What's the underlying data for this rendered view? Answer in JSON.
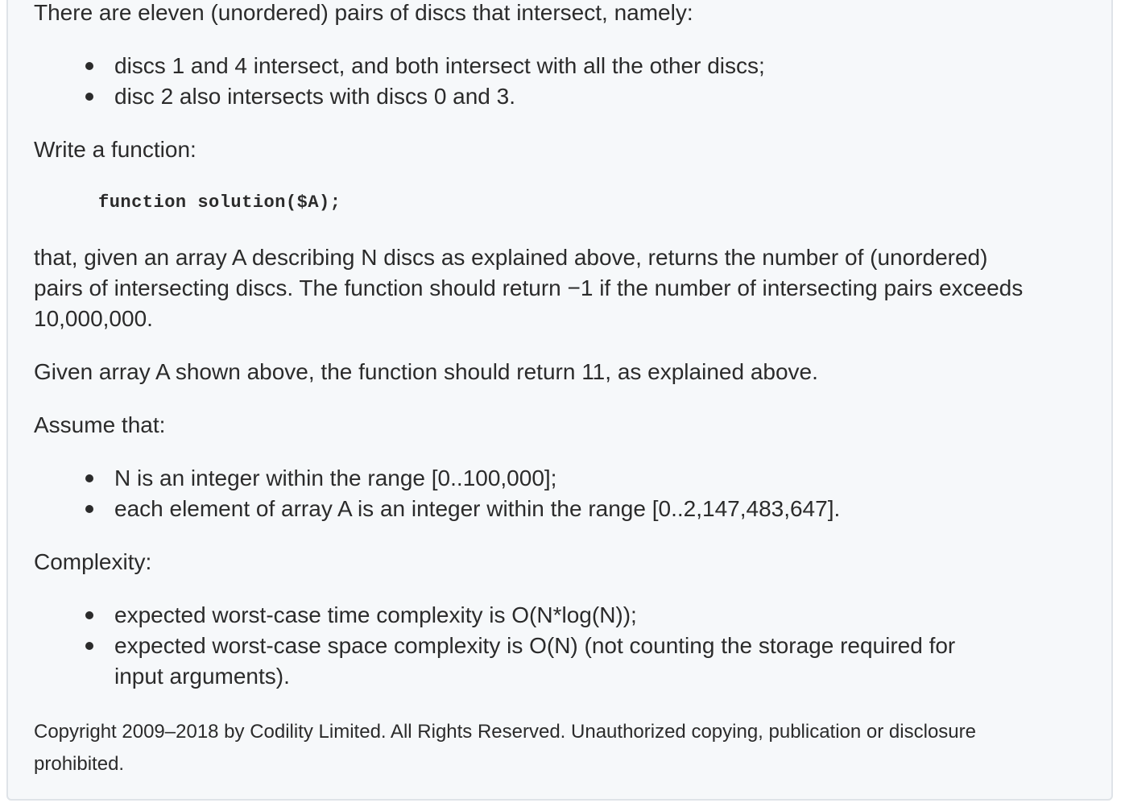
{
  "intro": "There are eleven (unordered) pairs of discs that intersect, namely:",
  "pairs_list": [
    "discs 1 and 4 intersect, and both intersect with all the other discs;",
    "disc 2 also intersects with discs 0 and 3."
  ],
  "write_function": "Write a function:",
  "signature": "function solution($A);",
  "description_lines": [
    "that, given an array A describing N discs as explained above, returns the number of (unordered)",
    "pairs of intersecting discs. The function should return −1 if the number of intersecting pairs exceeds",
    "10,000,000."
  ],
  "example": "Given array A shown above, the function should return 11, as explained above.",
  "assume_heading": "Assume that:",
  "assumptions": [
    "N is an integer within the range [0..100,000];",
    "each element of array A is an integer within the range [0..2,147,483,647]."
  ],
  "complexity_heading": "Complexity:",
  "complexity": {
    "time": "expected worst-case time complexity is O(N*log(N));",
    "space_line1": "expected worst-case space complexity is O(N) (not counting the storage required for",
    "space_line2": "input arguments)."
  },
  "copyright_lines": [
    "Copyright 2009–2018 by Codility Limited. All Rights Reserved. Unauthorized copying, publication or disclosure",
    "prohibited."
  ]
}
